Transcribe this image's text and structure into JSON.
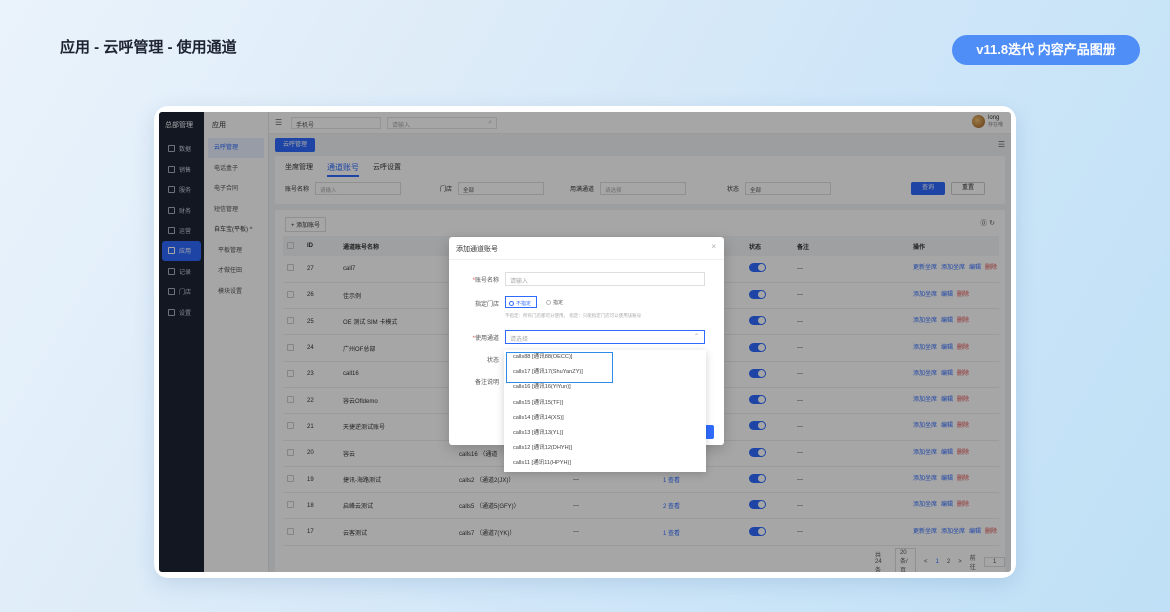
{
  "header": {
    "title": "应用 - 云呼管理 - 使用通道",
    "version_badge": "v11.8迭代 内容产品图册"
  },
  "nav": {
    "title": "总部管理",
    "items": [
      {
        "label": "数据"
      },
      {
        "label": "销售"
      },
      {
        "label": "服务"
      },
      {
        "label": "财务"
      },
      {
        "label": "运营"
      },
      {
        "label": "应用"
      },
      {
        "label": "记录"
      },
      {
        "label": "门店"
      },
      {
        "label": "设置"
      }
    ]
  },
  "submenu": {
    "title": "应用",
    "items": [
      "云呼管理",
      "电话盒子",
      "电子合同",
      "短信管理",
      "自车宝(平板) ^",
      "平板管理",
      "才做任田",
      "模块设置"
    ]
  },
  "topbar": {
    "phone_select": "手机号",
    "search_placeholder": "请输入",
    "user_name": "long",
    "user_sub": "存在哦"
  },
  "tabstrip": {
    "active_tab": "云呼管理"
  },
  "subtabs": {
    "items": [
      "坐席管理",
      "通道账号",
      "云呼设置"
    ]
  },
  "filters": {
    "account_label": "账号名称",
    "account_placeholder": "请输入",
    "store_label": "门店",
    "store_value": "全部",
    "channel_label": "用满通道",
    "channel_placeholder": "请选择",
    "status_label": "状态",
    "status_value": "全部",
    "query_btn": "查询",
    "reset_btn": "重置"
  },
  "toolbar": {
    "add_label": "+ 添加账号"
  },
  "table": {
    "headers": [
      "",
      "ID",
      "通道账号名称",
      "",
      "",
      "",
      "状态",
      "备注",
      "",
      "操作"
    ],
    "rows": [
      {
        "id": "27",
        "name": "call7",
        "cols": [
          "",
          "",
          ""
        ],
        "remark": "---",
        "actions": [
          "更新坐席",
          "添加坐席",
          "编辑",
          "删除"
        ]
      },
      {
        "id": "26",
        "name": "佳示例",
        "cols": [
          "",
          "",
          ""
        ],
        "remark": "---",
        "actions": [
          "添加坐席",
          "编辑",
          "删除"
        ]
      },
      {
        "id": "25",
        "name": "OE 测试 SIM 卡模式",
        "cols": [
          "",
          "",
          ""
        ],
        "remark": "---",
        "actions": [
          "添加坐席",
          "编辑",
          "删除"
        ]
      },
      {
        "id": "24",
        "name": "广州OF总部",
        "cols": [
          "",
          "",
          ""
        ],
        "remark": "---",
        "actions": [
          "添加坐席",
          "编辑",
          "删除"
        ]
      },
      {
        "id": "23",
        "name": "call16",
        "cols": [
          "",
          "",
          ""
        ],
        "remark": "---",
        "actions": [
          "添加坐席",
          "编辑",
          "删除"
        ]
      },
      {
        "id": "22",
        "name": "容云Ofldemo",
        "cols": [
          "",
          "",
          ""
        ],
        "remark": "---",
        "actions": [
          "添加坐席",
          "编辑",
          "删除"
        ]
      },
      {
        "id": "21",
        "name": "天捷逆测试账号",
        "cols": [
          "",
          "",
          ""
        ],
        "remark": "---",
        "actions": [
          "添加坐席",
          "编辑",
          "删除"
        ]
      },
      {
        "id": "20",
        "name": "容云",
        "cols": [
          "calls16 （通道",
          "",
          ""
        ],
        "remark": "---",
        "actions": [
          "添加坐席",
          "编辑",
          "删除"
        ]
      },
      {
        "id": "19",
        "name": "捷讯-海路测试",
        "cols": [
          "calls2 （通道2(JX)）",
          "---",
          "1 查看"
        ],
        "remark": "---",
        "actions": [
          "添加坐席",
          "编辑",
          "删除"
        ]
      },
      {
        "id": "18",
        "name": "启峰云测试",
        "cols": [
          "calls5 （通道5(GFY)）",
          "---",
          "2 查看"
        ],
        "remark": "---",
        "actions": [
          "添加坐席",
          "编辑",
          "删除"
        ]
      },
      {
        "id": "17",
        "name": "云客测试",
        "cols": [
          "calls7 （通道7(YK)）",
          "---",
          "1 查看"
        ],
        "remark": "---",
        "actions": [
          "更新坐席",
          "添加坐席",
          "编辑",
          "删除"
        ]
      }
    ]
  },
  "pagination": {
    "total": "共 24 条",
    "page_size": "20条/页",
    "prev": "<",
    "page1": "1",
    "page2": "2",
    "next": ">",
    "goto_label": "前往",
    "goto_value": "1",
    "page_suffix": "页"
  },
  "modal": {
    "title": "添加通道账号",
    "account_label": "账号名称",
    "account_placeholder": "请输入",
    "store_label": "指定门店",
    "radio_no": "不指定",
    "radio_yes": "指定",
    "hint": "不指定：所有门店都可分使用。 指定：只能指定门店可以使用该账号",
    "channel_label": "使用通道",
    "channel_placeholder": "请选择",
    "status_label": "状态",
    "remark_label": "备注说明"
  },
  "dropdown": {
    "options": [
      "calls88 [通讯88(OECC)]",
      "calls17 [通讯17(ShuYanZY)]",
      "calls16 [通讯16(YiYun)]",
      "calls15 [通讯15(TF)]",
      "calls14 [通讯14(XS)]",
      "calls13 [通讯13(YL)]",
      "calls12 [通讯12(DHYH)]",
      "calls11 [通讯11(HPYH)]"
    ]
  },
  "colors": {
    "accent": "#2f6bff",
    "badge": "#4f8ef7",
    "nav_bg": "#1e2435",
    "danger": "#e04848"
  }
}
